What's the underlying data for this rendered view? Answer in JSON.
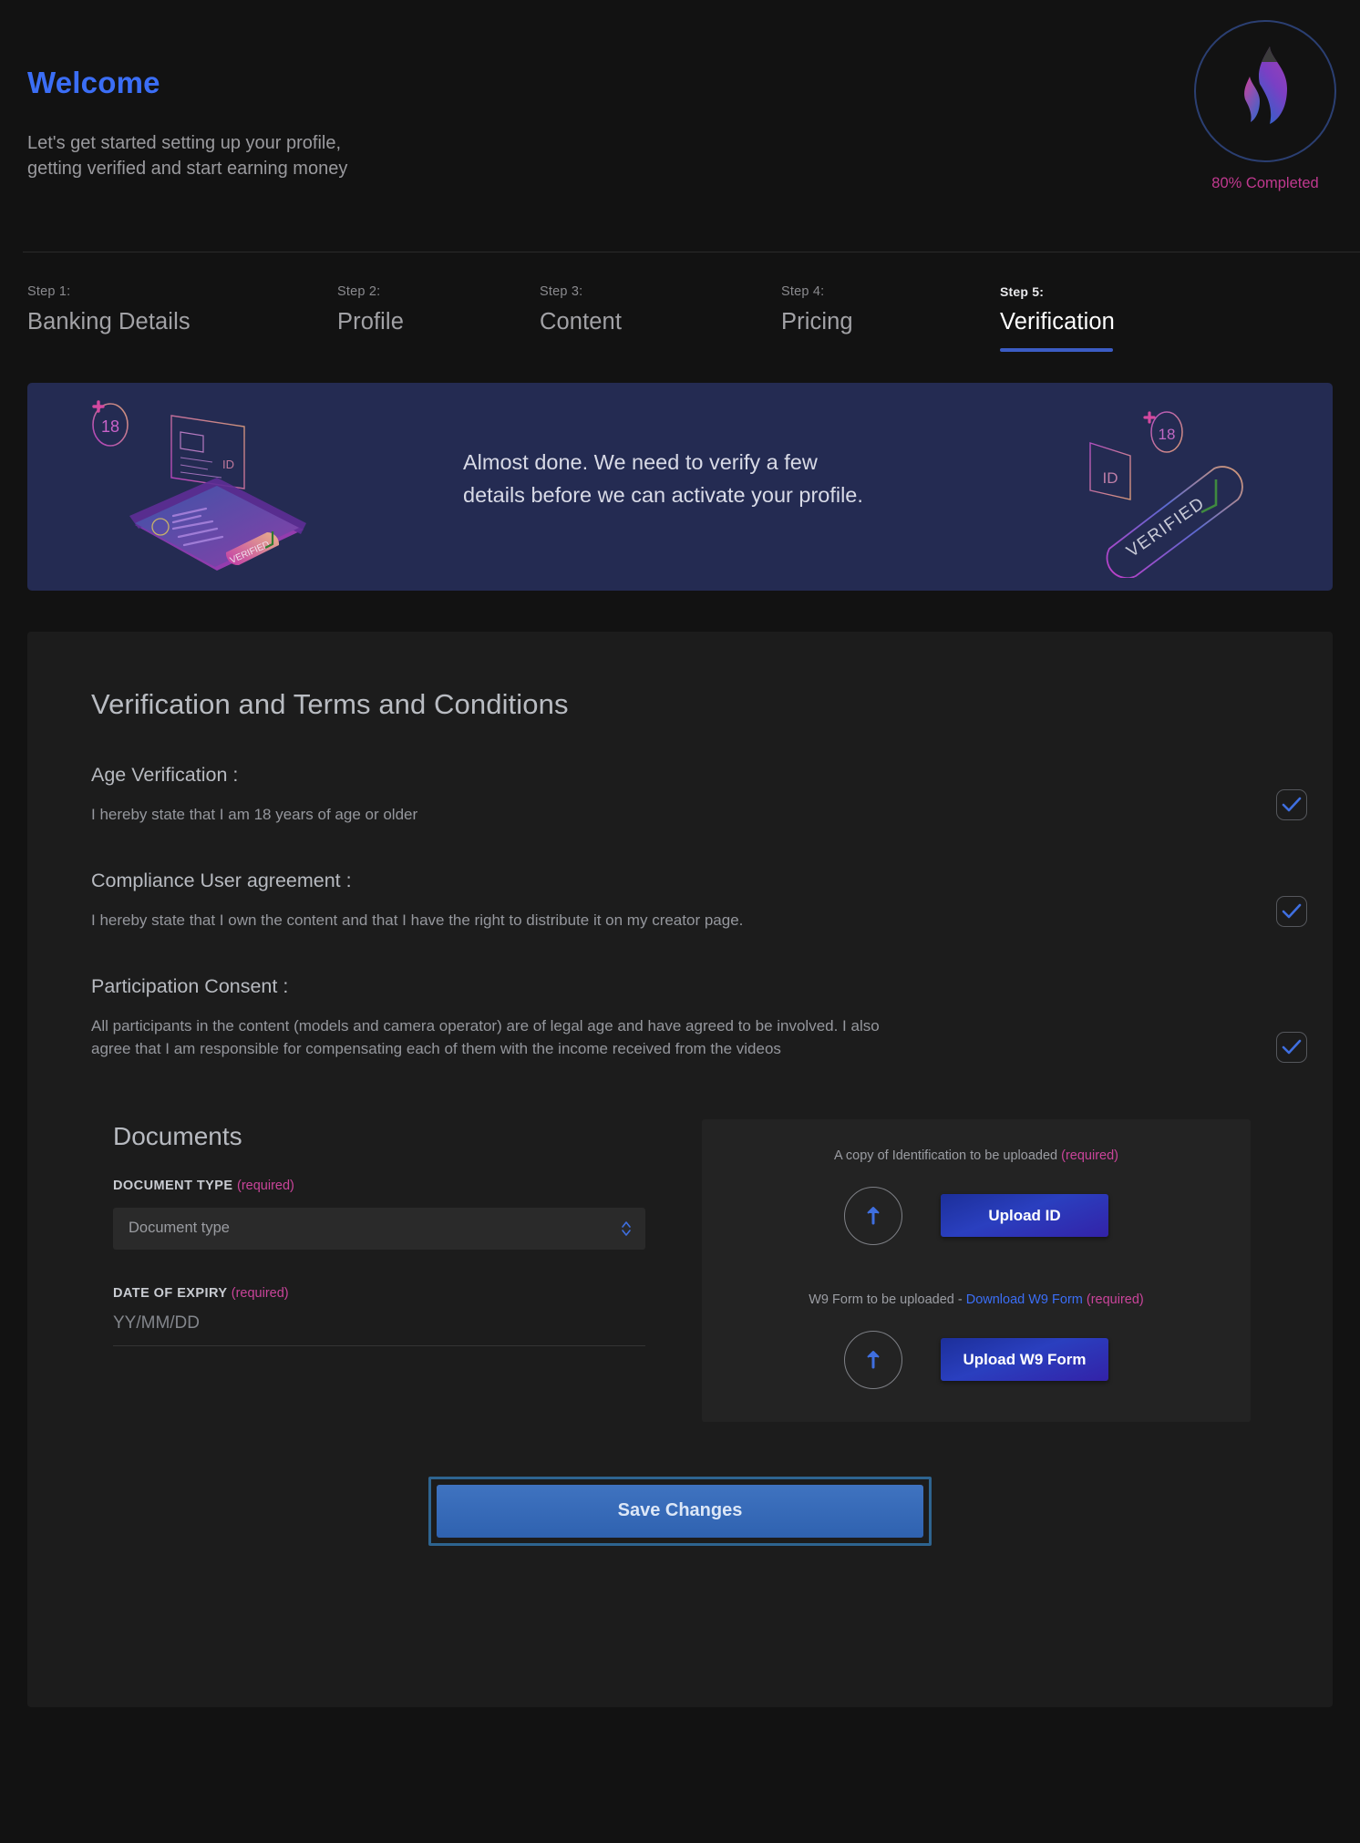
{
  "header": {
    "title": "Welcome",
    "subtitle_line1": "Let's get started setting up your profile,",
    "subtitle_line2": "getting verified and start earning money",
    "progress_label": "80% Completed",
    "progress_percent": 80,
    "logo_icon": "flame-logo-icon",
    "accent_blue": "#3b6ef6",
    "accent_pink": "#c0398f"
  },
  "stepper": {
    "steps": [
      {
        "index": "Step 1:",
        "label": "Banking Details",
        "active": false
      },
      {
        "index": "Step 2:",
        "label": "Profile",
        "active": false
      },
      {
        "index": "Step 3:",
        "label": "Content",
        "active": false
      },
      {
        "index": "Step 4:",
        "label": "Pricing",
        "active": false
      },
      {
        "index": "Step 5:",
        "label": "Verification",
        "active": true
      }
    ]
  },
  "banner": {
    "text_line1": "Almost done. We need to verify a few",
    "text_line2": "details before we can activate your profile.",
    "background": "#242b52",
    "art_left_icon": "phone-id-verification-illustration",
    "art_right_icon": "verified-badge-illustration",
    "art_labels": {
      "age": "18",
      "id": "ID",
      "verified": "VERIFIED"
    }
  },
  "card": {
    "title": "Verification and Terms and Conditions",
    "terms": [
      {
        "heading": "Age Verification :",
        "body": "I hereby state that I am 18 years of age or older",
        "checked": true
      },
      {
        "heading": "Compliance User agreement :",
        "body": "I hereby state that I own the content and that I have the right to distribute it on my creator page.",
        "checked": true
      },
      {
        "heading": "Participation Consent :",
        "body": "All participants in the content (models and camera operator) are of legal age and have agreed to be involved. I also agree that I am responsible for compensating each of them with the income received from the videos",
        "checked": true
      }
    ]
  },
  "documents": {
    "title": "Documents",
    "document_type": {
      "label": "DOCUMENT TYPE",
      "required_text": "(required)",
      "value": "",
      "placeholder": "Document type",
      "stepper_icon": "chevron-updown-icon"
    },
    "date_of_expiry": {
      "label": "DATE OF EXPIRY",
      "required_text": "(required)",
      "value": "",
      "placeholder": "YY/MM/DD"
    },
    "uploads": [
      {
        "caption": "A copy of Identification to be uploaded",
        "required_text": "(required)",
        "link_text": "",
        "button_label": "Upload ID",
        "icon": "upload-arrow-icon"
      },
      {
        "caption_prefix": "W9 Form to be uploaded - ",
        "link_text": "Download W9 Form",
        "required_text": "(required)",
        "button_label": "Upload W9 Form",
        "icon": "upload-arrow-icon"
      }
    ]
  },
  "footer": {
    "save_label": "Save Changes"
  }
}
